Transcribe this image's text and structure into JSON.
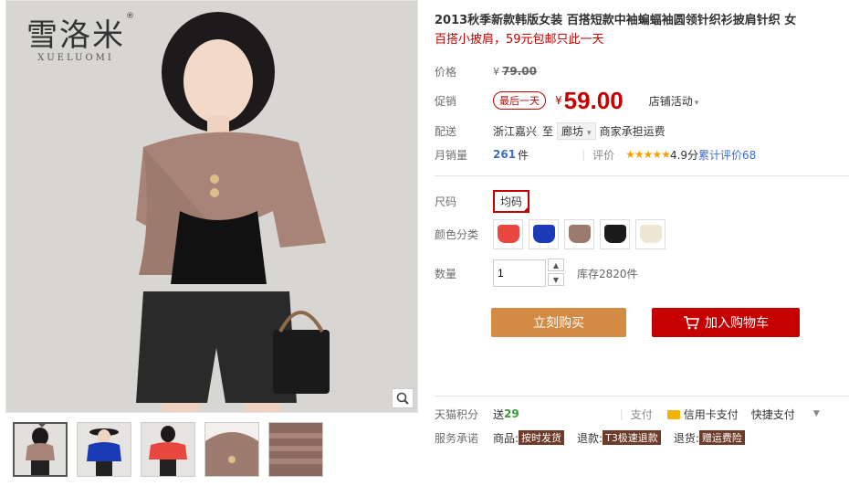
{
  "brand": {
    "logo_cn": "雪洛米",
    "logo_reg": "®",
    "logo_en": "XUELUOMI"
  },
  "product": {
    "title": "2013秋季新款韩版女装 百搭短款中袖蝙蝠袖圆领针织衫披肩针织 女",
    "subtitle": "百搭小披肩，59元包邮只此一天"
  },
  "price": {
    "label": "价格",
    "yen": "¥",
    "original": "79.00",
    "promo_label": "促销",
    "promo_badge": "最后一天",
    "promo_yen": "¥",
    "promo_price": "59.00",
    "shop_activity": "店铺活动"
  },
  "shipping": {
    "label": "配送",
    "from": "浙江嘉兴",
    "to_word": "至",
    "to_city": "廊坊",
    "fee_note": "商家承担运费"
  },
  "sales": {
    "label": "月销量",
    "count": "261",
    "unit": "件",
    "rating_label": "评价",
    "stars": "★★★★★",
    "score": "4.9分",
    "total_reviews": "累计评价68"
  },
  "size": {
    "label": "尺码",
    "option": "均码"
  },
  "color": {
    "label": "颜色分类",
    "swatches": [
      "#e8483f",
      "#1a3bb5",
      "#9a7b6e",
      "#1a1a1a",
      "#efe6d3"
    ]
  },
  "quantity": {
    "label": "数量",
    "value": "1",
    "stock": "库存2820件"
  },
  "actions": {
    "buy_now": "立刻购买",
    "add_to_cart": "加入购物车"
  },
  "services": {
    "points_label": "天猫积分",
    "points_prefix": "送",
    "points_value": "29",
    "pay_label": "支付",
    "credit_card": "信用卡支付",
    "quick_pay": "快捷支付",
    "promise_label": "服务承诺",
    "goods": "商品:",
    "goods_tag": "按时发货",
    "refund": "退款:",
    "refund_tag": "T3极速退款",
    "return": "退货:",
    "return_tag": "赠运费险"
  }
}
